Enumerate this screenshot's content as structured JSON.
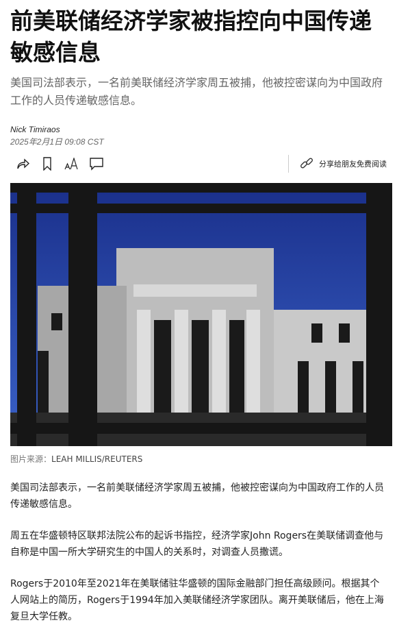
{
  "headline": "前美联储经济学家被指控向中国传递敏感信息",
  "subheadline": "美国司法部表示，一名前美联储经济学家周五被捕，他被控密谋向为中国政府工作的人员传递敏感信息。",
  "author": "Nick Timiraos",
  "date": "2025年2月1日 09:08 CST",
  "toolbar": {
    "share_free": "分享给朋友免费阅读"
  },
  "photo": {
    "credit_label": "图片来源：",
    "credit": "LEAH MILLIS/REUTERS"
  },
  "paragraphs": [
    "美国司法部表示，一名前美联储经济学家周五被捕，他被控密谋向为中国政府工作的人员传递敏感信息。",
    "周五在华盛顿特区联邦法院公布的起诉书指控，经济学家John Rogers在美联储调查他与自称是中国一所大学研究生的中国人的关系时，对调查人员撒谎。",
    "Rogers于2010年至2021年在美联储驻华盛顿的国际金融部门担任高级顾问。根据其个人网站上的简历，Rogers于1994年加入美联储经济学家团队。离开美联储后，他在上海复旦大学任教。"
  ]
}
